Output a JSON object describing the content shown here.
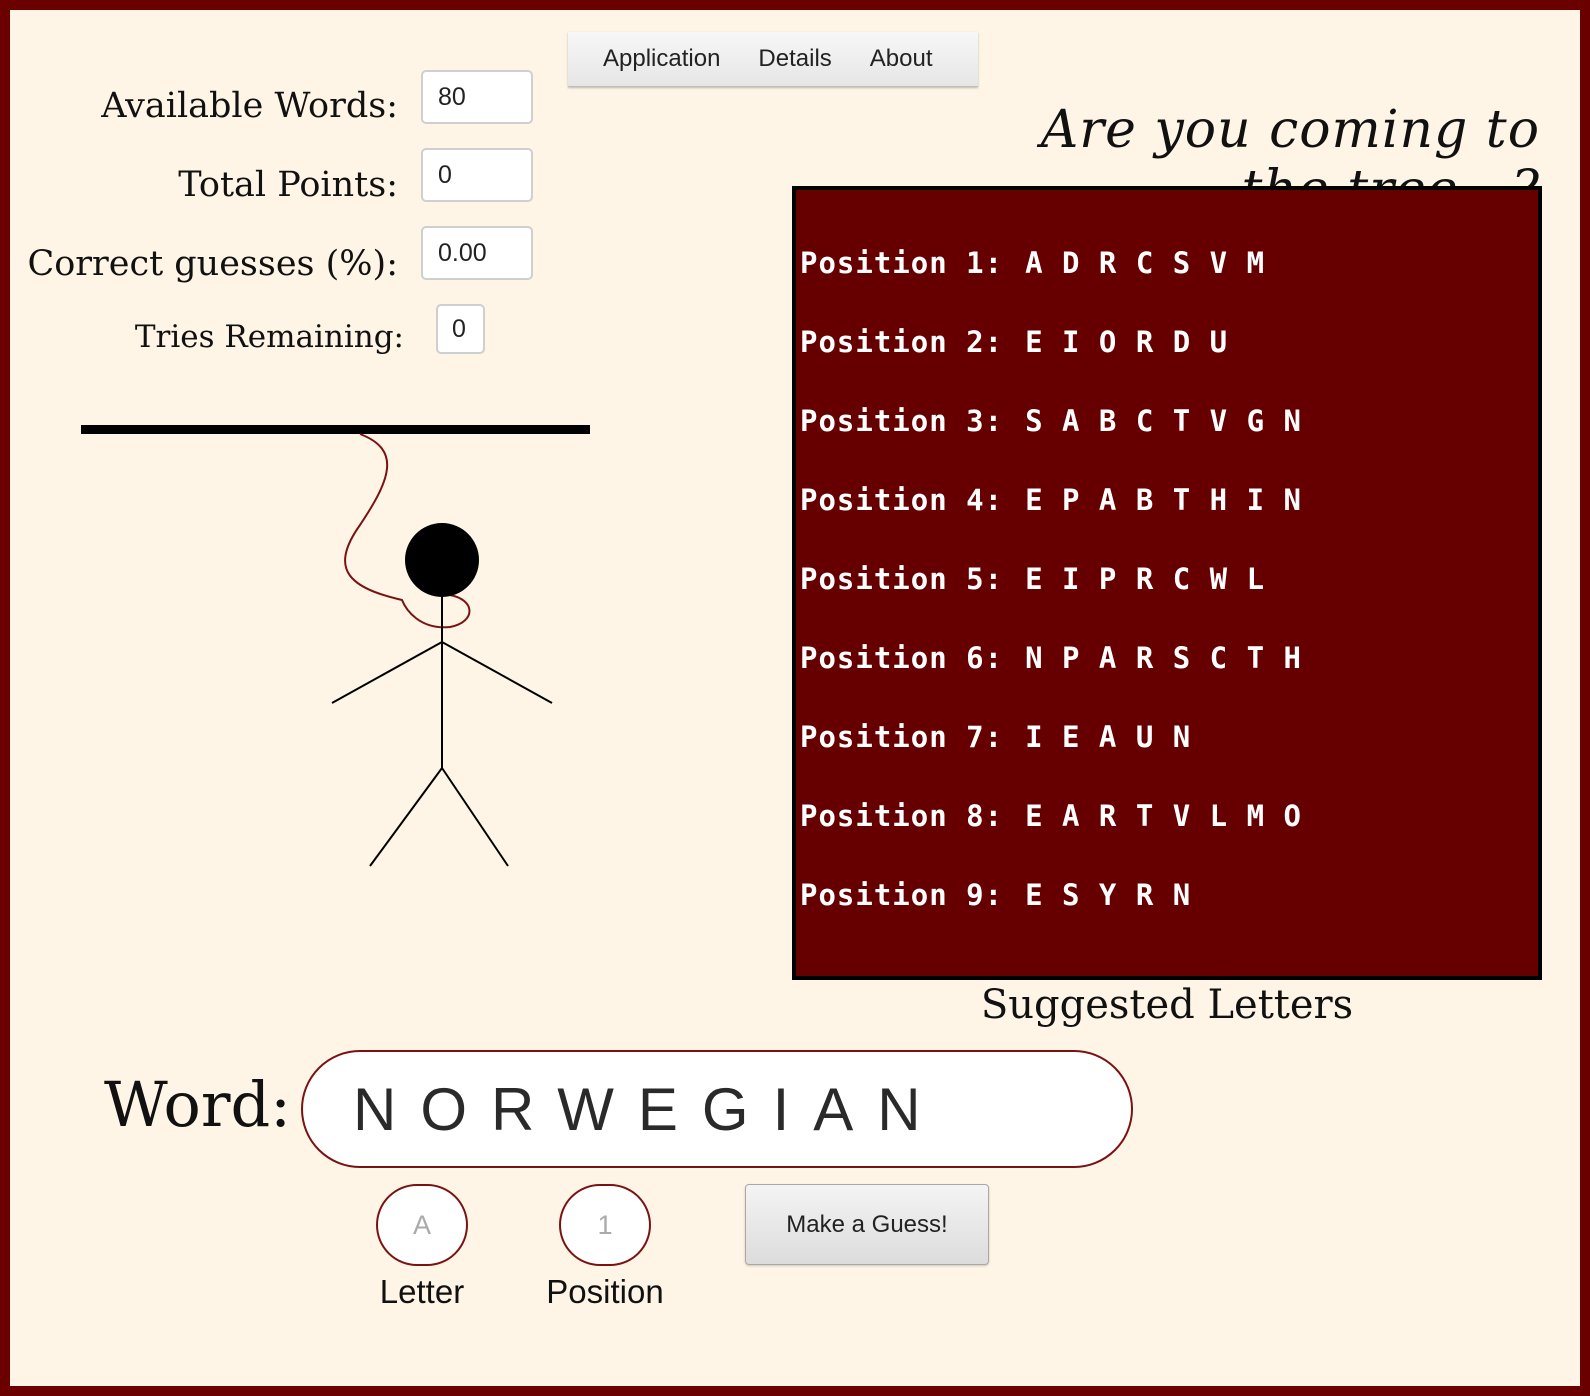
{
  "menu": {
    "items": [
      "Application",
      "Details",
      "About"
    ]
  },
  "stats": {
    "available_words_label": "Available Words:",
    "available_words_value": "80",
    "total_points_label": "Total Points:",
    "total_points_value": "0",
    "correct_guesses_label": "Correct guesses (%):",
    "correct_guesses_value": "0.00",
    "tries_remaining_label": "Tries Remaining:",
    "tries_remaining_value": "0"
  },
  "tagline": "Are you coming to the tree...?",
  "suggestions": {
    "rows": [
      {
        "label": "Position 1:",
        "letters": "A D R C S V M"
      },
      {
        "label": "Position 2:",
        "letters": "E I O R D U"
      },
      {
        "label": "Position 3:",
        "letters": "S A B C T V G N"
      },
      {
        "label": "Position 4:",
        "letters": "E P A B T H I N"
      },
      {
        "label": "Position 5:",
        "letters": "E I P R C W L"
      },
      {
        "label": "Position 6:",
        "letters": "N P A R S C T H"
      },
      {
        "label": "Position 7:",
        "letters": "I E A U N"
      },
      {
        "label": "Position 8:",
        "letters": "E A R T V L M O"
      },
      {
        "label": "Position 9:",
        "letters": "E S Y R N"
      }
    ],
    "caption": "Suggested Letters"
  },
  "word": {
    "label": "Word:",
    "value": "NORWEGIAN"
  },
  "guess": {
    "letter_placeholder": "A",
    "letter_caption": "Letter",
    "position_placeholder": "1",
    "position_caption": "Position",
    "button_label": "Make a Guess!"
  },
  "colors": {
    "background": "#fef5e6",
    "frame": "#6a0000",
    "panel": "#660000",
    "rope": "#7a1212"
  }
}
